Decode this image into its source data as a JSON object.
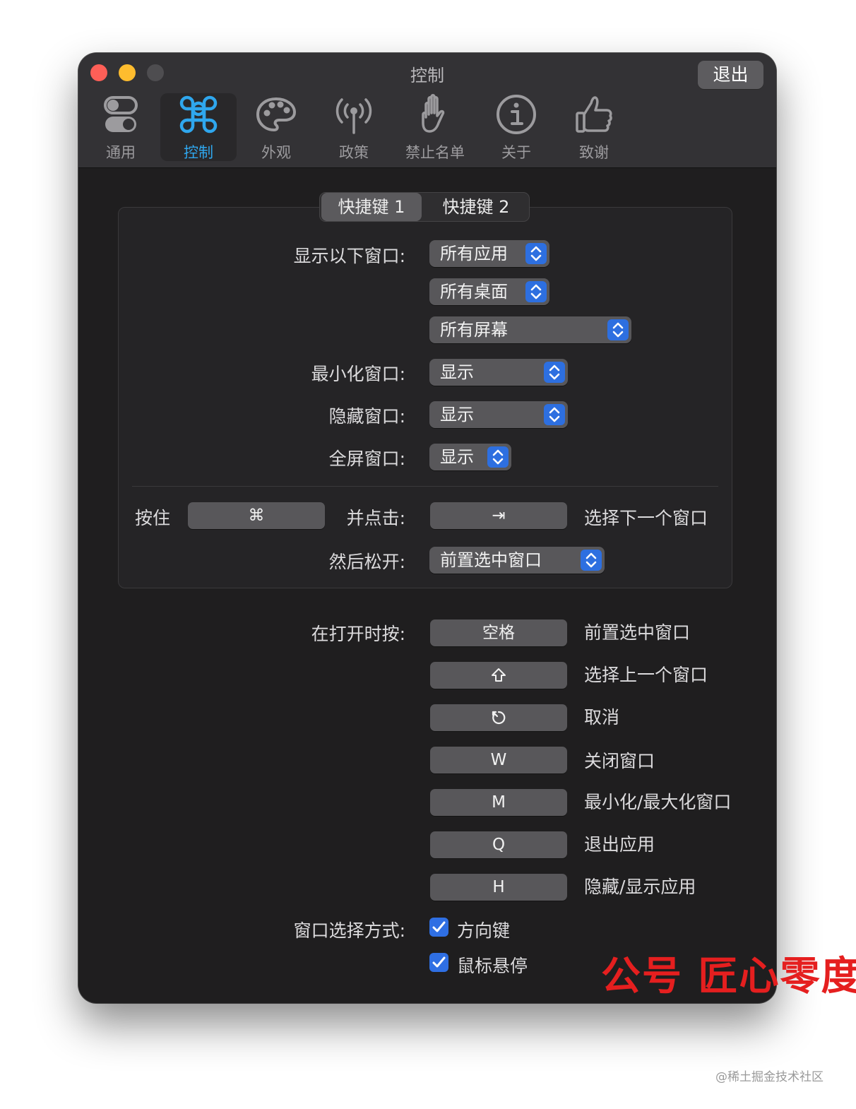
{
  "window": {
    "title": "控制",
    "quit_label": "退出"
  },
  "toolbar": {
    "tabs": [
      {
        "label": "通用",
        "icon": "toggle-switch-icon"
      },
      {
        "label": "控制",
        "icon": "command-key-icon",
        "active": true
      },
      {
        "label": "外观",
        "icon": "palette-icon"
      },
      {
        "label": "政策",
        "icon": "broadcast-antenna-icon"
      },
      {
        "label": "禁止名单",
        "icon": "hand-stop-icon"
      },
      {
        "label": "关于",
        "icon": "info-circle-icon"
      },
      {
        "label": "致谢",
        "icon": "thumbs-up-icon"
      }
    ]
  },
  "shortcut_tabs": {
    "items": [
      {
        "label": "快捷键 1",
        "active": true
      },
      {
        "label": "快捷键 2",
        "active": false
      }
    ]
  },
  "show_windows": {
    "label": "显示以下窗口:",
    "app_filter": "所有应用",
    "desktop_filter": "所有桌面",
    "screen_filter": "所有屏幕"
  },
  "minimized": {
    "label": "最小化窗口:",
    "value": "显示"
  },
  "hidden": {
    "label": "隐藏窗口:",
    "value": "显示"
  },
  "fullscreen": {
    "label": "全屏窗口:",
    "value": "显示"
  },
  "hold": {
    "label": "按住",
    "modifier_key": "⌘",
    "click_label": "并点击:",
    "trigger_key": "⇥",
    "trigger_description": "选择下一个窗口"
  },
  "release": {
    "label": "然后松开:",
    "value": "前置选中窗口"
  },
  "while_open": {
    "label": "在打开时按:",
    "keys": [
      {
        "key": "空格",
        "description": "前置选中窗口"
      },
      {
        "key": "⇧",
        "description": "选择上一个窗口"
      },
      {
        "key": "⎋",
        "description": "取消"
      },
      {
        "key": "W",
        "description": "关闭窗口"
      },
      {
        "key": "M",
        "description": "最小化/最大化窗口"
      },
      {
        "key": "Q",
        "description": "退出应用"
      },
      {
        "key": "H",
        "description": "隐藏/显示应用"
      }
    ]
  },
  "selection_method": {
    "label": "窗口选择方式:",
    "options": [
      {
        "label": "方向键",
        "checked": true
      },
      {
        "label": "鼠标悬停",
        "checked": true
      }
    ]
  },
  "overlay": {
    "watermark": "公号  匠心零度",
    "credit": "@稀土掘金技术社区"
  },
  "colors": {
    "accent": "#2fa7ee",
    "checkbox": "#2f6fe3",
    "watermark": "#e51f1f"
  }
}
